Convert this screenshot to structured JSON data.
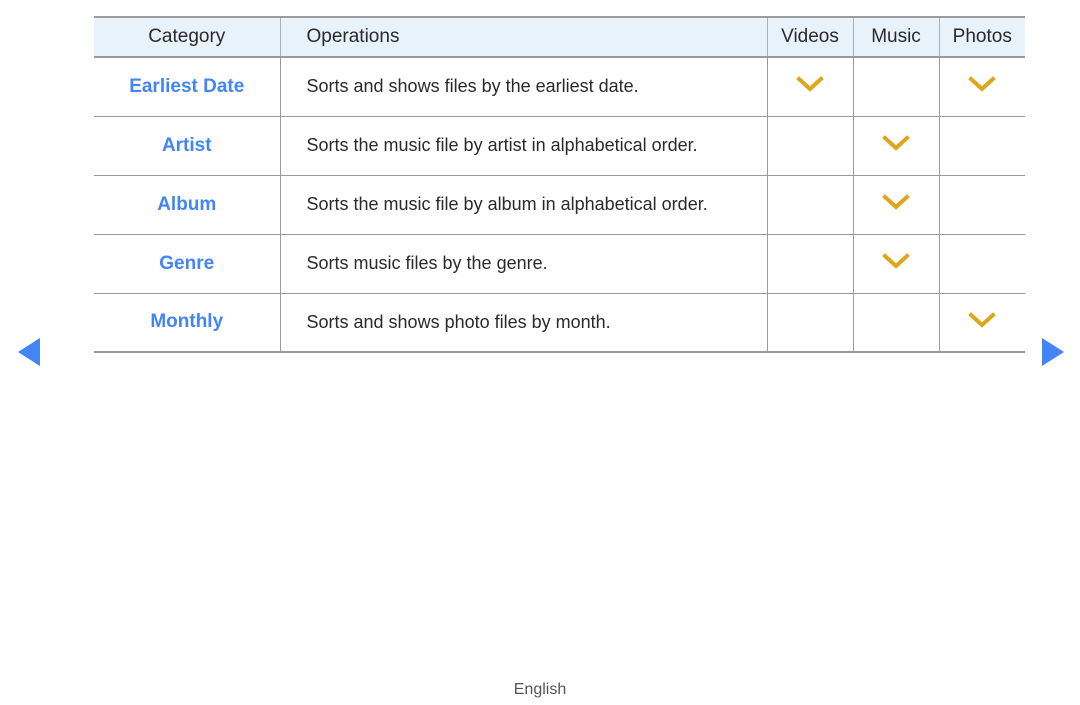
{
  "table": {
    "columns": [
      {
        "key": "category",
        "label": "Category"
      },
      {
        "key": "operations",
        "label": "Operations"
      },
      {
        "key": "videos",
        "label": "Videos"
      },
      {
        "key": "music",
        "label": "Music"
      },
      {
        "key": "photos",
        "label": "Photos"
      }
    ],
    "rows": [
      {
        "category": "Earliest Date",
        "operations": "Sorts and shows files by the earliest date.",
        "videos": true,
        "music": false,
        "photos": true
      },
      {
        "category": "Artist",
        "operations": "Sorts the music file by artist in alphabetical order.",
        "videos": false,
        "music": true,
        "photos": false
      },
      {
        "category": "Album",
        "operations": "Sorts the music file by album in alphabetical order.",
        "videos": false,
        "music": true,
        "photos": false
      },
      {
        "category": "Genre",
        "operations": "Sorts music files by the genre.",
        "videos": false,
        "music": true,
        "photos": false
      },
      {
        "category": "Monthly",
        "operations": "Sorts and shows photo files by month.",
        "videos": false,
        "music": false,
        "photos": true
      }
    ]
  },
  "navigation": {
    "prev_icon": "triangle-left-icon",
    "next_icon": "triangle-right-icon",
    "arrow_color": "#4285f4"
  },
  "marks": {
    "icon": "chevron-down-icon",
    "color": "#dfa61c"
  },
  "colors": {
    "category_link": "#4285f4",
    "header_background": "#e7f2fa",
    "border": "#9a9a9a",
    "text": "#2a2a2a",
    "footer_text": "#555555"
  },
  "footer": {
    "language": "English"
  }
}
